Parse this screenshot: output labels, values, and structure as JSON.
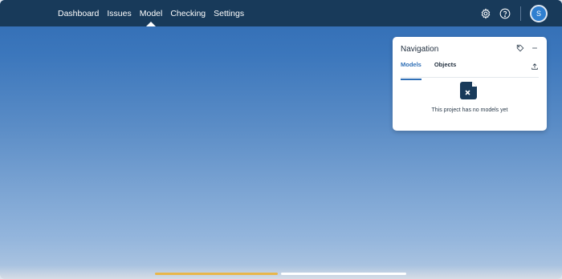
{
  "nav": {
    "items": [
      "Dashboard",
      "Issues",
      "Model",
      "Checking",
      "Settings"
    ],
    "active_index": 2
  },
  "user": {
    "avatar_initial": "S"
  },
  "panel": {
    "title": "Navigation",
    "tabs": [
      "Models",
      "Objects"
    ],
    "active_tab": 0,
    "empty_message": "This project has no models yet"
  },
  "icons": {
    "settings": "gear-icon",
    "help": "help-icon",
    "tag": "tag-icon",
    "minimize": "minimize-icon",
    "upload": "upload-icon",
    "empty": "no-file-icon"
  },
  "colors": {
    "topbar": "#183a5a",
    "accent": "#2f6fb6",
    "progress_loaded": "#e8b64a",
    "progress_remaining": "#ffffff"
  },
  "progress": {
    "loaded_fraction": 0.49
  }
}
